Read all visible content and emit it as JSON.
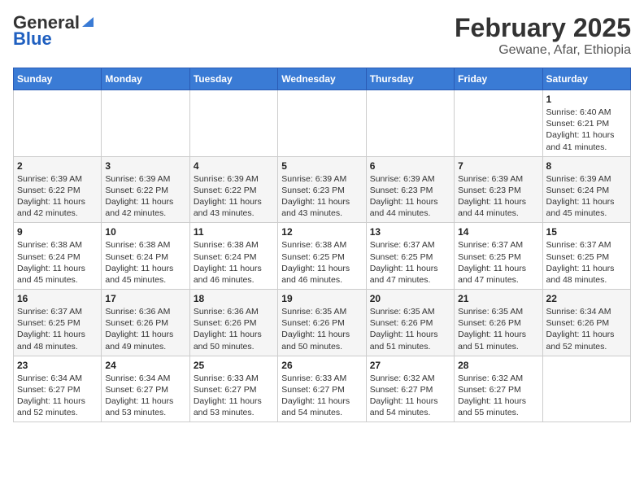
{
  "header": {
    "logo_general": "General",
    "logo_blue": "Blue",
    "main_title": "February 2025",
    "sub_title": "Gewane, Afar, Ethiopia"
  },
  "calendar": {
    "days_of_week": [
      "Sunday",
      "Monday",
      "Tuesday",
      "Wednesday",
      "Thursday",
      "Friday",
      "Saturday"
    ],
    "weeks": [
      [
        {
          "day": "",
          "info": ""
        },
        {
          "day": "",
          "info": ""
        },
        {
          "day": "",
          "info": ""
        },
        {
          "day": "",
          "info": ""
        },
        {
          "day": "",
          "info": ""
        },
        {
          "day": "",
          "info": ""
        },
        {
          "day": "1",
          "info": "Sunrise: 6:40 AM\nSunset: 6:21 PM\nDaylight: 11 hours and 41 minutes."
        }
      ],
      [
        {
          "day": "2",
          "info": "Sunrise: 6:39 AM\nSunset: 6:22 PM\nDaylight: 11 hours and 42 minutes."
        },
        {
          "day": "3",
          "info": "Sunrise: 6:39 AM\nSunset: 6:22 PM\nDaylight: 11 hours and 42 minutes."
        },
        {
          "day": "4",
          "info": "Sunrise: 6:39 AM\nSunset: 6:22 PM\nDaylight: 11 hours and 43 minutes."
        },
        {
          "day": "5",
          "info": "Sunrise: 6:39 AM\nSunset: 6:23 PM\nDaylight: 11 hours and 43 minutes."
        },
        {
          "day": "6",
          "info": "Sunrise: 6:39 AM\nSunset: 6:23 PM\nDaylight: 11 hours and 44 minutes."
        },
        {
          "day": "7",
          "info": "Sunrise: 6:39 AM\nSunset: 6:23 PM\nDaylight: 11 hours and 44 minutes."
        },
        {
          "day": "8",
          "info": "Sunrise: 6:39 AM\nSunset: 6:24 PM\nDaylight: 11 hours and 45 minutes."
        }
      ],
      [
        {
          "day": "9",
          "info": "Sunrise: 6:38 AM\nSunset: 6:24 PM\nDaylight: 11 hours and 45 minutes."
        },
        {
          "day": "10",
          "info": "Sunrise: 6:38 AM\nSunset: 6:24 PM\nDaylight: 11 hours and 45 minutes."
        },
        {
          "day": "11",
          "info": "Sunrise: 6:38 AM\nSunset: 6:24 PM\nDaylight: 11 hours and 46 minutes."
        },
        {
          "day": "12",
          "info": "Sunrise: 6:38 AM\nSunset: 6:25 PM\nDaylight: 11 hours and 46 minutes."
        },
        {
          "day": "13",
          "info": "Sunrise: 6:37 AM\nSunset: 6:25 PM\nDaylight: 11 hours and 47 minutes."
        },
        {
          "day": "14",
          "info": "Sunrise: 6:37 AM\nSunset: 6:25 PM\nDaylight: 11 hours and 47 minutes."
        },
        {
          "day": "15",
          "info": "Sunrise: 6:37 AM\nSunset: 6:25 PM\nDaylight: 11 hours and 48 minutes."
        }
      ],
      [
        {
          "day": "16",
          "info": "Sunrise: 6:37 AM\nSunset: 6:25 PM\nDaylight: 11 hours and 48 minutes."
        },
        {
          "day": "17",
          "info": "Sunrise: 6:36 AM\nSunset: 6:26 PM\nDaylight: 11 hours and 49 minutes."
        },
        {
          "day": "18",
          "info": "Sunrise: 6:36 AM\nSunset: 6:26 PM\nDaylight: 11 hours and 50 minutes."
        },
        {
          "day": "19",
          "info": "Sunrise: 6:35 AM\nSunset: 6:26 PM\nDaylight: 11 hours and 50 minutes."
        },
        {
          "day": "20",
          "info": "Sunrise: 6:35 AM\nSunset: 6:26 PM\nDaylight: 11 hours and 51 minutes."
        },
        {
          "day": "21",
          "info": "Sunrise: 6:35 AM\nSunset: 6:26 PM\nDaylight: 11 hours and 51 minutes."
        },
        {
          "day": "22",
          "info": "Sunrise: 6:34 AM\nSunset: 6:26 PM\nDaylight: 11 hours and 52 minutes."
        }
      ],
      [
        {
          "day": "23",
          "info": "Sunrise: 6:34 AM\nSunset: 6:27 PM\nDaylight: 11 hours and 52 minutes."
        },
        {
          "day": "24",
          "info": "Sunrise: 6:34 AM\nSunset: 6:27 PM\nDaylight: 11 hours and 53 minutes."
        },
        {
          "day": "25",
          "info": "Sunrise: 6:33 AM\nSunset: 6:27 PM\nDaylight: 11 hours and 53 minutes."
        },
        {
          "day": "26",
          "info": "Sunrise: 6:33 AM\nSunset: 6:27 PM\nDaylight: 11 hours and 54 minutes."
        },
        {
          "day": "27",
          "info": "Sunrise: 6:32 AM\nSunset: 6:27 PM\nDaylight: 11 hours and 54 minutes."
        },
        {
          "day": "28",
          "info": "Sunrise: 6:32 AM\nSunset: 6:27 PM\nDaylight: 11 hours and 55 minutes."
        },
        {
          "day": "",
          "info": ""
        }
      ]
    ]
  }
}
